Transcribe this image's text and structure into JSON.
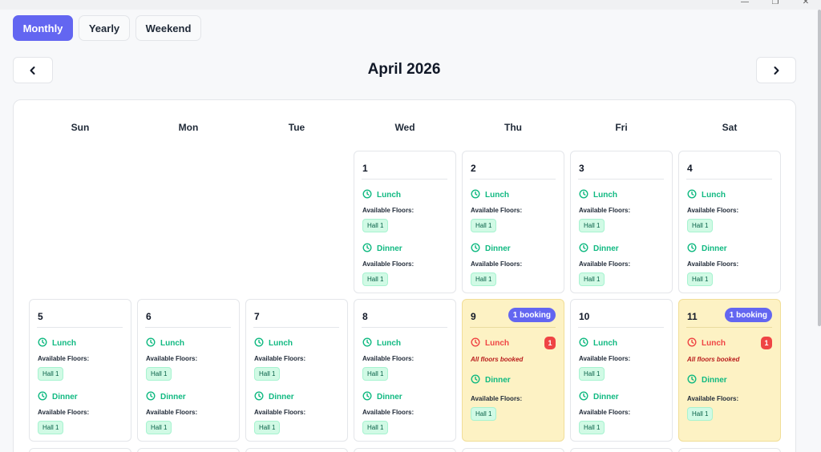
{
  "window": {
    "minimize_glyph": "—",
    "maximize_glyph": "❐",
    "close_glyph": "✕"
  },
  "view_tabs": [
    {
      "label": "Monthly",
      "active": true
    },
    {
      "label": "Yearly",
      "active": false
    },
    {
      "label": "Weekend",
      "active": false
    }
  ],
  "calendar_header": {
    "title": "April 2026",
    "prev_icon": "chevron-left-icon",
    "next_icon": "chevron-right-icon"
  },
  "weekdays": [
    "Sun",
    "Mon",
    "Tue",
    "Wed",
    "Thu",
    "Fri",
    "Sat"
  ],
  "labels": {
    "lunch": "Lunch",
    "dinner": "Dinner",
    "available_floors": "Available Floors:",
    "all_booked": "All floors booked",
    "hall": "Hall 1"
  },
  "colors": {
    "accent": "#6366f1",
    "available": "#10b981",
    "booked_bg": "#fdf2c4",
    "full": "#ef4444"
  },
  "days": [
    {
      "day": "1",
      "col": 3,
      "row": 0
    },
    {
      "day": "2",
      "col": 4,
      "row": 0
    },
    {
      "day": "3",
      "col": 5,
      "row": 0
    },
    {
      "day": "4",
      "col": 6,
      "row": 0
    },
    {
      "day": "5",
      "col": 0,
      "row": 1
    },
    {
      "day": "6",
      "col": 1,
      "row": 1
    },
    {
      "day": "7",
      "col": 2,
      "row": 1
    },
    {
      "day": "8",
      "col": 3,
      "row": 1
    },
    {
      "day": "9",
      "col": 4,
      "row": 1,
      "booking_badge": "1 booking",
      "lunch_full_count": "1"
    },
    {
      "day": "10",
      "col": 5,
      "row": 1
    },
    {
      "day": "11",
      "col": 6,
      "row": 1,
      "booking_badge": "1 booking",
      "lunch_full_count": "1"
    }
  ]
}
